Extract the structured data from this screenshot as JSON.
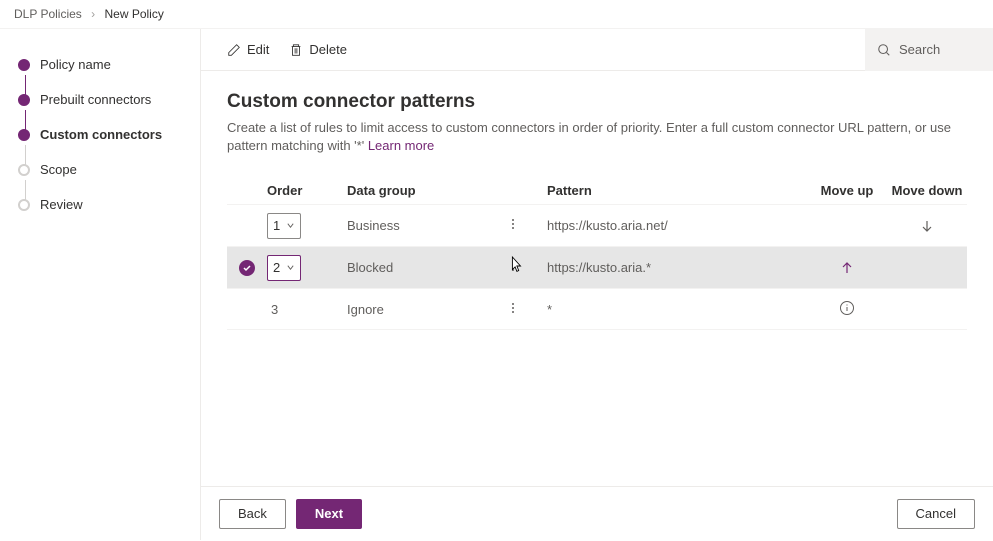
{
  "breadcrumb": {
    "parent": "DLP Policies",
    "current": "New Policy"
  },
  "sidebar": {
    "steps": [
      {
        "label": "Policy name",
        "state": "done"
      },
      {
        "label": "Prebuilt connectors",
        "state": "done"
      },
      {
        "label": "Custom connectors",
        "state": "active"
      },
      {
        "label": "Scope",
        "state": "todo"
      },
      {
        "label": "Review",
        "state": "todo"
      }
    ]
  },
  "toolbar": {
    "edit": "Edit",
    "delete": "Delete"
  },
  "search": {
    "placeholder": "Search"
  },
  "page": {
    "title": "Custom connector patterns",
    "description": "Create a list of rules to limit access to custom connectors in order of priority. Enter a full custom connector URL pattern, or use pattern matching with '*' ",
    "learn_more": "Learn more"
  },
  "table": {
    "headers": {
      "order": "Order",
      "data_group": "Data group",
      "pattern": "Pattern",
      "move_up": "Move up",
      "move_down": "Move down"
    },
    "rows": [
      {
        "selected": false,
        "order": "1",
        "order_editable": true,
        "data_group": "Business",
        "pattern": "https://kusto.aria.net/",
        "move_up": false,
        "move_down": true,
        "info": false
      },
      {
        "selected": true,
        "order": "2",
        "order_editable": true,
        "data_group": "Blocked",
        "pattern": "https://kusto.aria.*",
        "move_up": true,
        "move_down": false,
        "info": false
      },
      {
        "selected": false,
        "order": "3",
        "order_editable": false,
        "data_group": "Ignore",
        "pattern": "*",
        "move_up": false,
        "move_down": false,
        "info": true
      }
    ]
  },
  "footer": {
    "back": "Back",
    "next": "Next",
    "cancel": "Cancel"
  }
}
